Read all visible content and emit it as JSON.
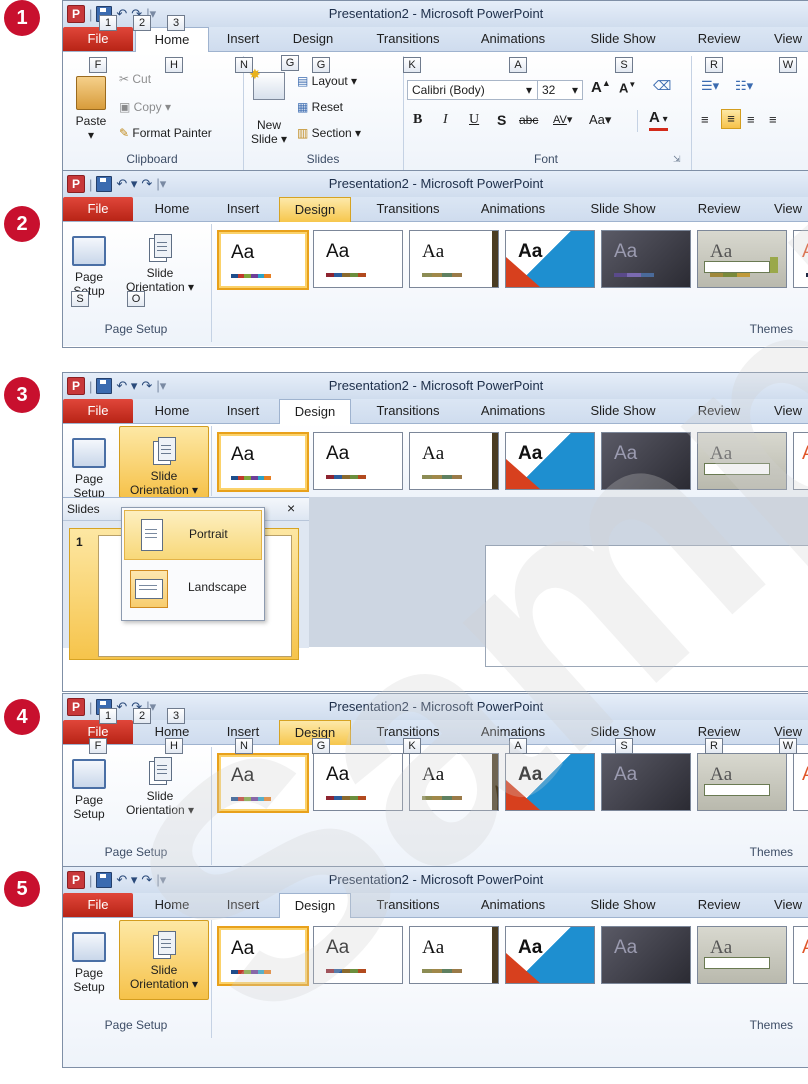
{
  "steps": [
    {
      "number": "1"
    },
    {
      "number": "2"
    },
    {
      "number": "3"
    },
    {
      "number": "4"
    },
    {
      "number": "5"
    }
  ],
  "window_title": "Presentation2 - Microsoft PowerPoint",
  "app_icon_letter": "P",
  "tabs": {
    "file": "File",
    "home": "Home",
    "insert": "Insert",
    "design": "Design",
    "transitions": "Transitions",
    "animations": "Animations",
    "slide_show": "Slide Show",
    "review": "Review",
    "view": "View"
  },
  "keytips": {
    "qat": [
      "1",
      "2",
      "3"
    ],
    "tabs": {
      "file": "F",
      "home": "H",
      "insert": "N",
      "design": "G",
      "transitions": "K",
      "animations": "A",
      "slide_show": "S",
      "review": "R",
      "view": "W"
    },
    "page_setup": "S",
    "slide_orientation": "O"
  },
  "home_ribbon": {
    "paste": "Paste",
    "cut": "Cut",
    "copy": "Copy",
    "format_painter": "Format Painter",
    "clipboard_group": "Clipboard",
    "new_slide_line1": "New",
    "new_slide_line2": "Slide",
    "layout": "Layout",
    "reset": "Reset",
    "section": "Section",
    "slides_group": "Slides",
    "font_name": "Calibri (Body)",
    "font_size": "32",
    "font_group": "Font",
    "bold": "B",
    "italic": "I",
    "underline": "U",
    "shadow": "S",
    "strike": "abc",
    "spacing": "AV",
    "change_case": "Aa",
    "font_color": "A"
  },
  "design_ribbon": {
    "page_setup_line1": "Page",
    "page_setup_line2": "Setup",
    "slide_orientation_line1": "Slide",
    "slide_orientation_line2": "Orientation",
    "page_setup_group": "Page Setup",
    "themes_group": "Themes",
    "theme_sample": "Aa"
  },
  "orientation_menu": {
    "portrait": "Portrait",
    "landscape": "Landscape"
  },
  "slides_pane": {
    "tab": "Slides",
    "close": "×",
    "slide_number": "1"
  },
  "watermark": "Sample",
  "colors": {
    "badge": "#c8102e",
    "file_tab": "#c8281a",
    "highlight": "#f6c549",
    "ribbon_border": "#9fb3cf"
  }
}
